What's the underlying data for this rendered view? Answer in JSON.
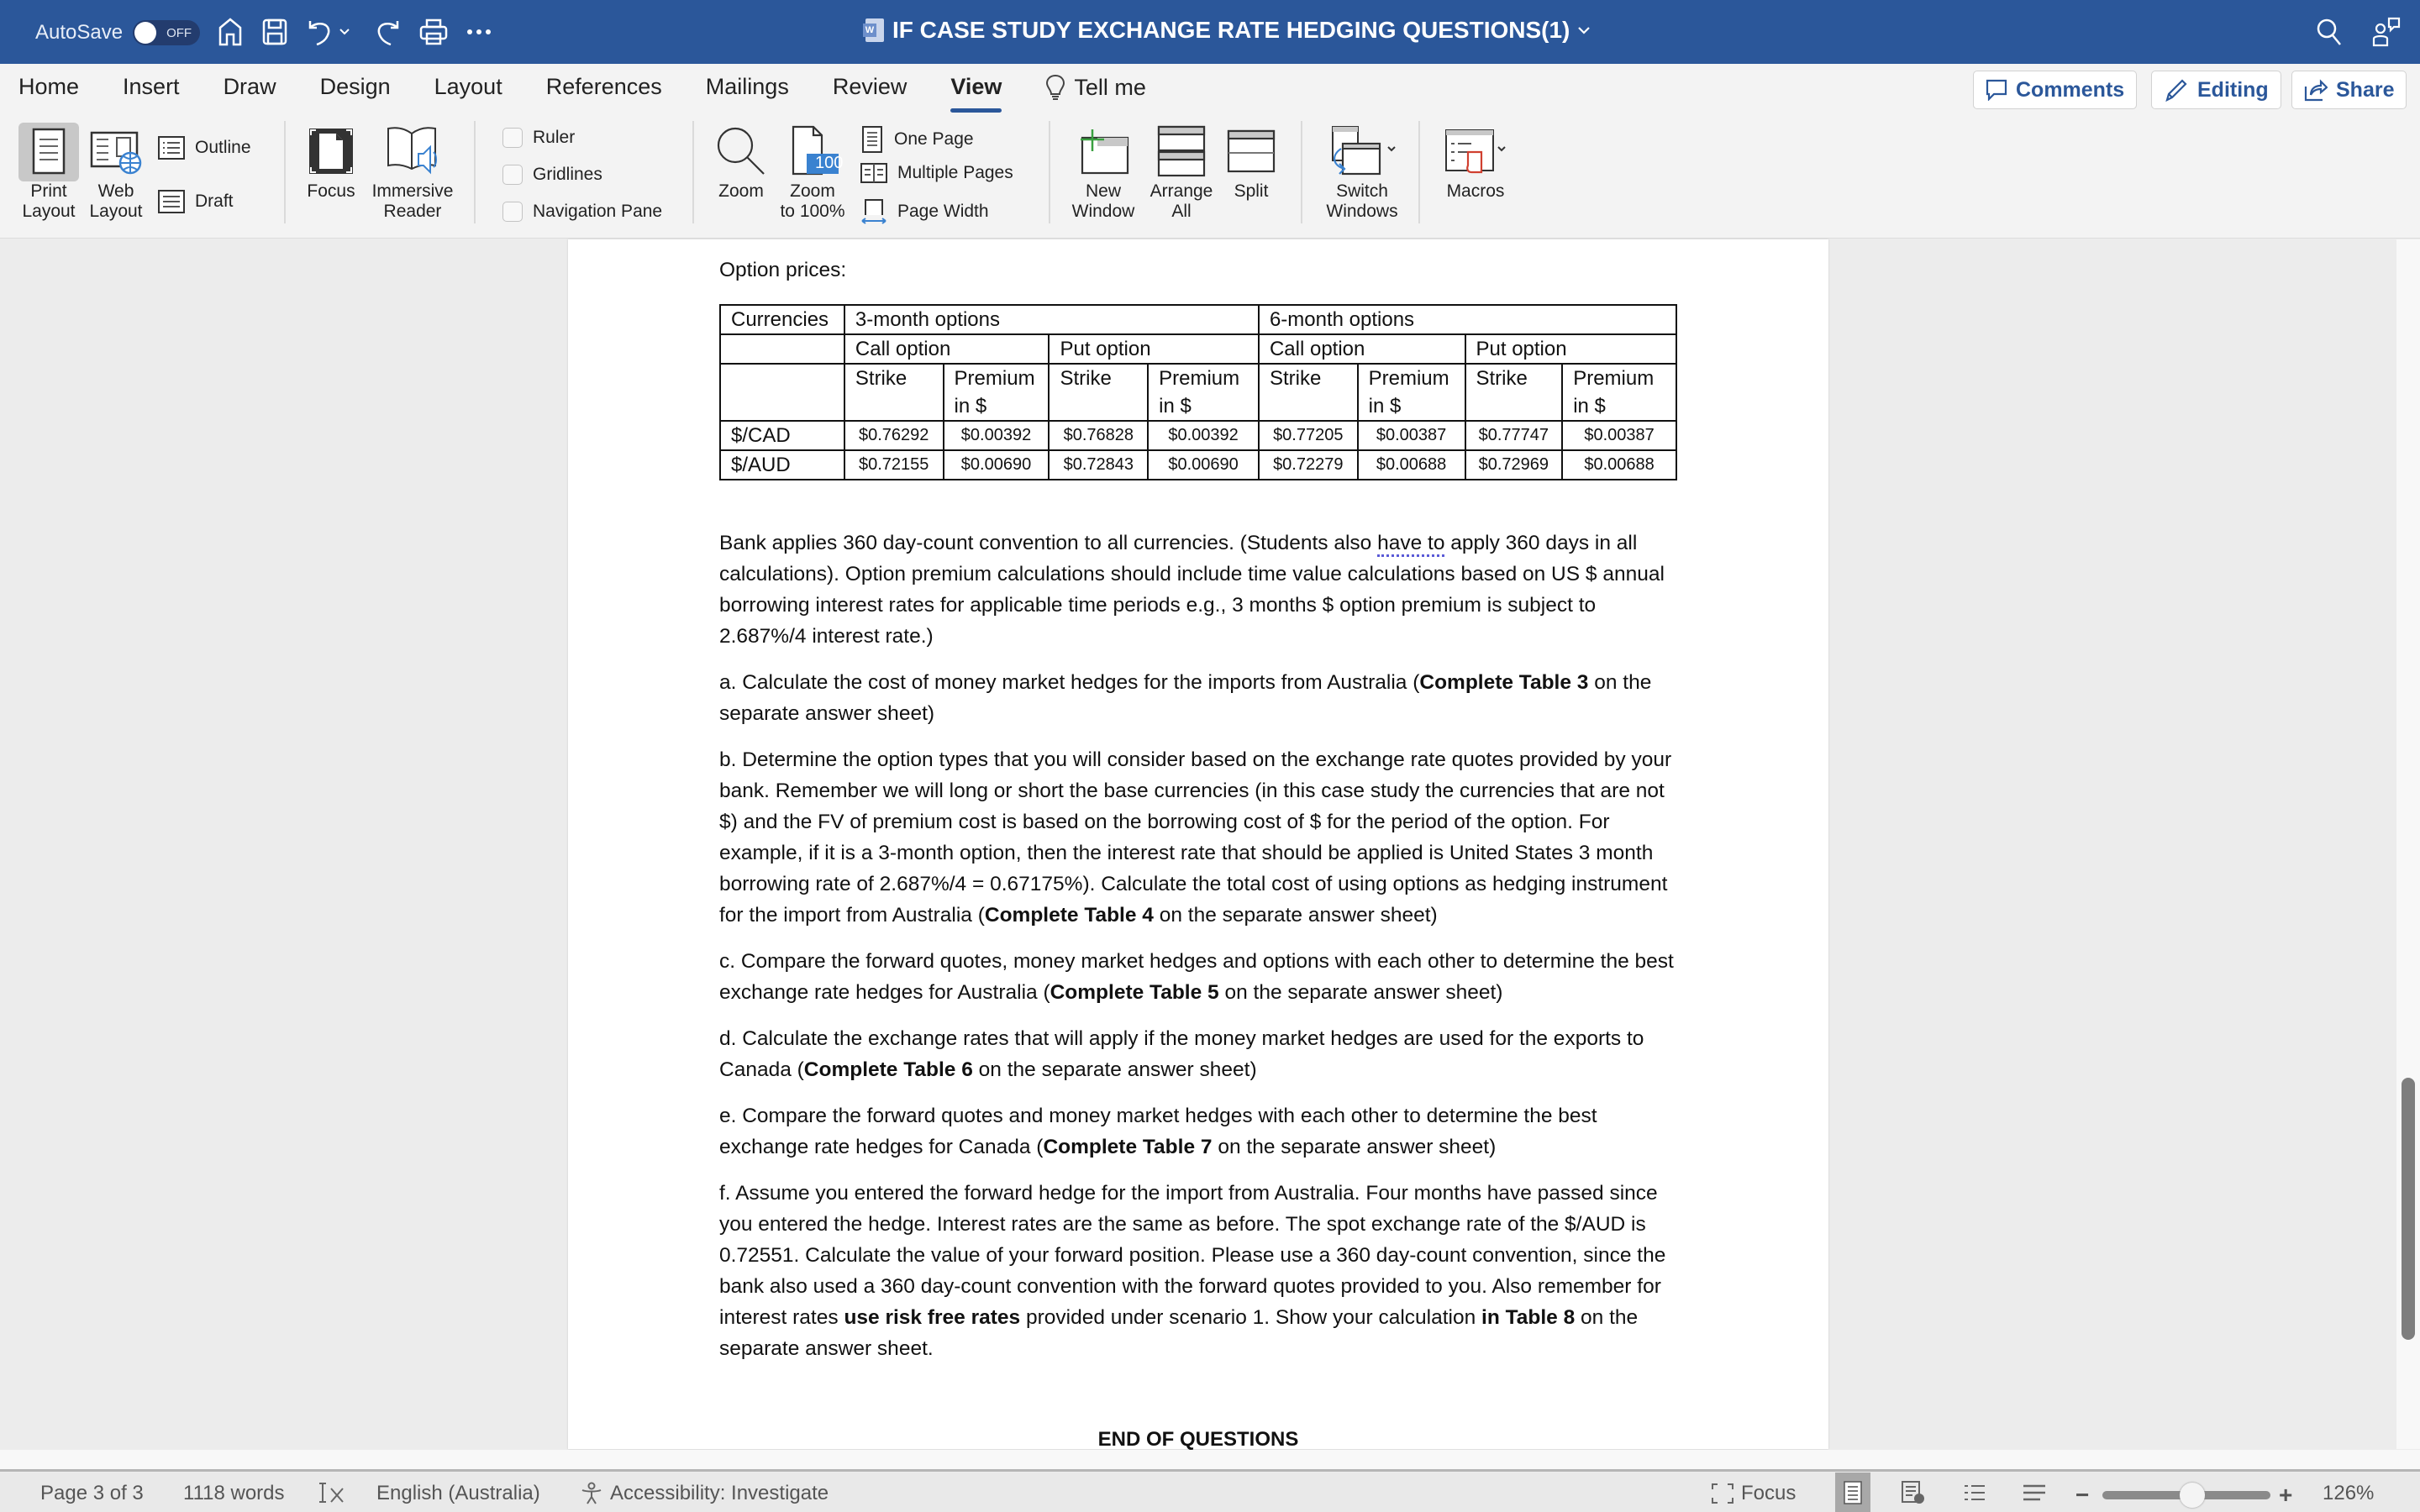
{
  "titlebar": {
    "autosave_label": "AutoSave",
    "autosave_state": "OFF",
    "document_title": "IF CASE STUDY EXCHANGE RATE HEDGING QUESTIONS(1)",
    "icons": [
      "home-icon",
      "save-icon",
      "undo-icon",
      "redo-icon",
      "print-icon",
      "more-icon",
      "search-icon",
      "collaborate-icon"
    ]
  },
  "ribbon": {
    "tabs": [
      "Home",
      "Insert",
      "Draw",
      "Design",
      "Layout",
      "References",
      "Mailings",
      "Review",
      "View"
    ],
    "active_tab": "View",
    "tell_me": "Tell me",
    "comments_label": "Comments",
    "editing_label": "Editing",
    "share_label": "Share",
    "views": {
      "print_layout": "Print Layout",
      "print_layout_line1": "Print",
      "print_layout_line2": "Layout",
      "web_layout_line1": "Web",
      "web_layout_line2": "Layout",
      "outline": "Outline",
      "draft": "Draft"
    },
    "immersive": {
      "focus": "Focus",
      "immersive_line1": "Immersive",
      "immersive_line2": "Reader"
    },
    "show": {
      "ruler": "Ruler",
      "gridlines": "Gridlines",
      "navigation_pane": "Navigation Pane"
    },
    "zoom": {
      "zoom": "Zoom",
      "zoom100_line1": "Zoom",
      "zoom100_line2": "to 100%",
      "zoom100_badge": "100",
      "one_page": "One Page",
      "multiple_pages": "Multiple Pages",
      "page_width": "Page Width"
    },
    "window": {
      "new_line1": "New",
      "new_line2": "Window",
      "arrange_line1": "Arrange",
      "arrange_line2": "All",
      "split": "Split",
      "switch_line1": "Switch",
      "switch_line2": "Windows"
    },
    "macros": "Macros"
  },
  "document": {
    "option_prices_label": "Option prices:",
    "table": {
      "row1": {
        "currencies": "Currencies",
        "three_month": "3-month options",
        "six_month": "6-month options"
      },
      "row2": {
        "call3": "Call option",
        "put3": "Put option",
        "call6": "Call option",
        "put6": "Put option"
      },
      "row3": [
        "Strike",
        "Premium in $",
        "Strike",
        "Premium in $",
        "Strike",
        "Premium in $",
        "Strike",
        "Premium in $"
      ],
      "rows": [
        {
          "currency": "$/CAD",
          "values": [
            "$0.76292",
            "$0.00392",
            "$0.76828",
            "$0.00392",
            "$0.77205",
            "$0.00387",
            "$0.77747",
            "$0.00387"
          ]
        },
        {
          "currency": "$/AUD",
          "values": [
            "$0.72155",
            "$0.00690",
            "$0.72843",
            "$0.00690",
            "$0.72279",
            "$0.00688",
            "$0.72969",
            "$0.00688"
          ]
        }
      ]
    },
    "intro": {
      "part1": "Bank applies 360 day-count convention to all currencies. (Students also ",
      "squiggle": "have to",
      "part2": " apply 360 days in all calculations). Option premium calculations should include time value calculations based on US $ annual borrowing interest rates for applicable time periods e.g., 3 months $ option premium is subject to 2.687%/4 interest rate.)"
    },
    "q_a": {
      "pre": "a. Calculate the cost of money market hedges for the imports from Australia (",
      "bold": "Complete Table 3",
      "post": " on the separate answer sheet)"
    },
    "q_b": {
      "pre": "b. Determine the option types that you will consider based on the exchange rate quotes provided by your bank. Remember we will long or short the base currencies (in this case study the currencies that are not $) and the FV of premium cost is based on the borrowing cost of $ for the period of the option. For example, if it is a 3-month option, then the interest rate that should be applied is United States 3 month borrowing rate of 2.687%/4 = 0.67175%). Calculate the total cost of using options as hedging instrument for the import from Australia (",
      "bold": "Complete Table 4",
      "post": " on the separate answer sheet)"
    },
    "q_c": {
      "pre": "c. Compare the forward quotes, money market hedges and options with each other to determine the best exchange rate hedges for Australia (",
      "bold": "Complete Table 5",
      "post": " on the separate answer sheet)"
    },
    "q_d": {
      "pre": "d. Calculate the exchange rates that will apply if the money market hedges are used for the exports to Canada (",
      "bold": "Complete Table 6",
      "post": " on the separate answer sheet)"
    },
    "q_e": {
      "pre": "e. Compare the forward quotes and money market hedges with each other to determine the best exchange rate hedges for Canada (",
      "bold": "Complete Table 7",
      "post": " on the separate answer sheet)"
    },
    "q_f": {
      "pre": "f. Assume you entered the forward hedge for the import from Australia. Four months have passed since you entered the hedge. Interest rates are the same as before. The spot exchange rate of the $/AUD is 0.72551. Calculate the value of your forward position. Please use a 360 day-count convention, since the bank also used a 360 day-count convention with the forward quotes provided to you. Also remember for interest rates ",
      "bold1": "use risk free rates",
      "mid": " provided under scenario 1. Show your calculation ",
      "bold2": "in Table 8",
      "post": " on the separate answer sheet."
    },
    "end_label": "END OF QUESTIONS"
  },
  "statusbar": {
    "page": "Page 3 of 3",
    "words": "1118 words",
    "language": "English (Australia)",
    "accessibility": "Accessibility: Investigate",
    "focus": "Focus",
    "zoom_percent": "126%",
    "zoom_value": 126
  },
  "scroll": {
    "vertical_position_fraction": 0.78
  }
}
